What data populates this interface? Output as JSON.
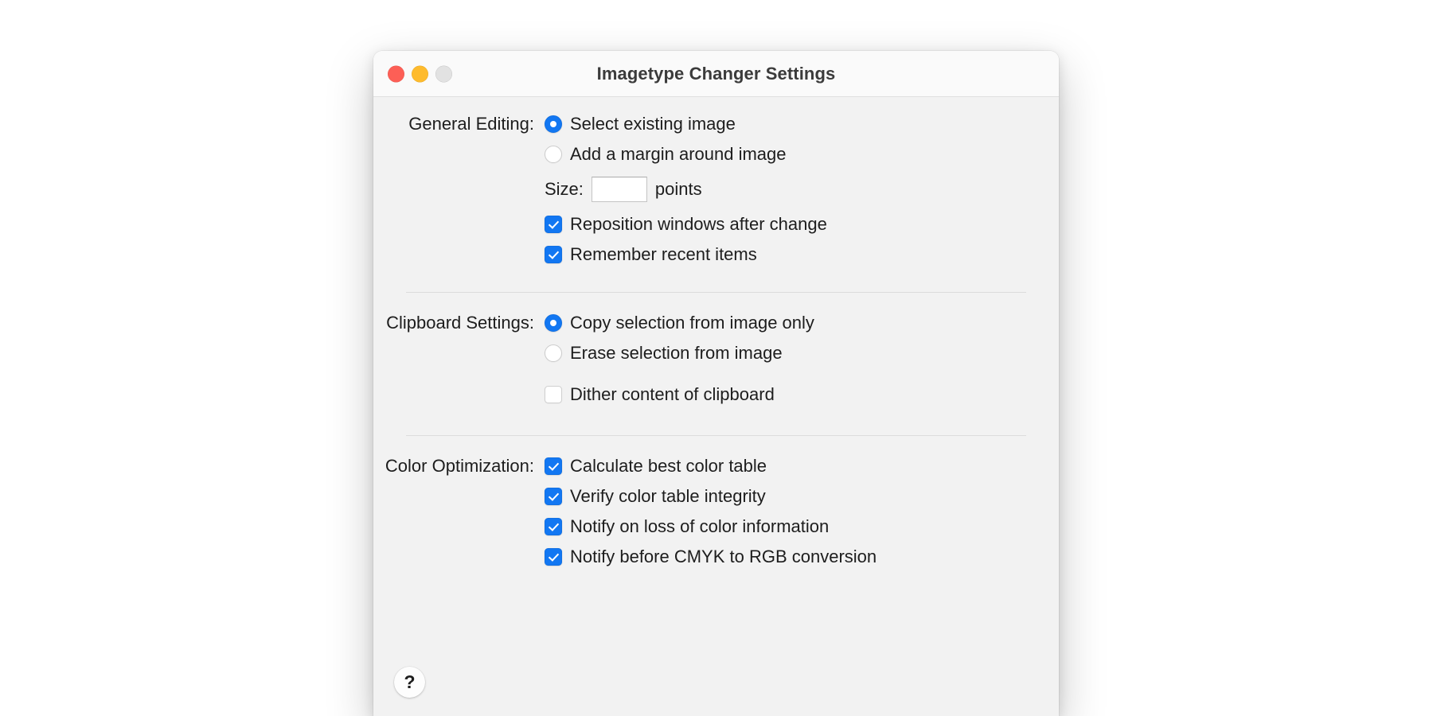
{
  "window": {
    "title": "Imagetype Changer Settings",
    "traffic_lights": [
      {
        "name": "close",
        "color": "#fd5f56"
      },
      {
        "name": "minimize",
        "color": "#febb2d"
      },
      {
        "name": "zoom",
        "color": "#e2e2e2"
      }
    ]
  },
  "accent_color": "#1277f2",
  "sections": {
    "general": {
      "label": "General Editing:",
      "radio_selected_index": 0,
      "radios": [
        {
          "label": "Select existing image",
          "checked": true
        },
        {
          "label": "Add a margin around image",
          "checked": false
        }
      ],
      "size": {
        "label": "Size:",
        "value": "",
        "placeholder": "",
        "unit": "points"
      },
      "checkboxes": [
        {
          "label": "Reposition windows after change",
          "checked": true
        },
        {
          "label": "Remember recent items",
          "checked": true
        }
      ]
    },
    "clipboard": {
      "label": "Clipboard Settings:",
      "radio_selected_index": 0,
      "radios": [
        {
          "label": "Copy selection from image only",
          "checked": true
        },
        {
          "label": "Erase selection from image",
          "checked": false
        }
      ],
      "checkboxes": [
        {
          "label": "Dither content of clipboard",
          "checked": false
        }
      ]
    },
    "color": {
      "label": "Color Optimization:",
      "checkboxes": [
        {
          "label": "Calculate best color table",
          "checked": true
        },
        {
          "label": "Verify color table integrity",
          "checked": true
        },
        {
          "label": "Notify on loss of color information",
          "checked": true
        },
        {
          "label": "Notify before CMYK to RGB conversion",
          "checked": true
        }
      ]
    }
  },
  "help_button": {
    "label": "?",
    "icon": "question-mark-icon"
  }
}
